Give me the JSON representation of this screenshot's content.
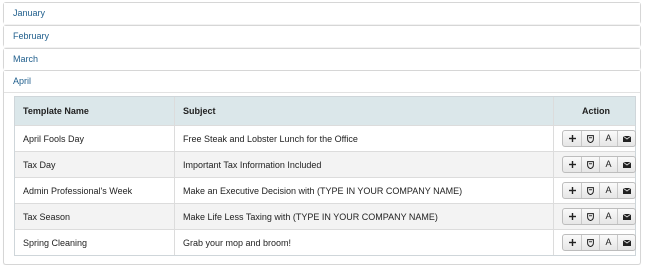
{
  "months": {
    "january": "January",
    "february": "February",
    "march": "March",
    "april": "April"
  },
  "table": {
    "headers": {
      "name": "Template Name",
      "subject": "Subject",
      "action": "Action"
    },
    "rows": [
      {
        "name": "April Fools Day",
        "subject": "Free Steak and Lobster Lunch for the Office"
      },
      {
        "name": "Tax Day",
        "subject": "Important Tax Information Included"
      },
      {
        "name": "Admin Professional's Week",
        "subject": "Make an Executive Decision with (TYPE IN YOUR COMPANY NAME)"
      },
      {
        "name": "Tax Season",
        "subject": "Make Life Less Taxing with (TYPE IN YOUR COMPANY NAME)"
      },
      {
        "name": "Spring Cleaning",
        "subject": "Grab your mop and broom!"
      }
    ]
  },
  "actions": {
    "add_icon": "plus-icon",
    "preview_icon": "shield-icon",
    "font_icon": "font-icon",
    "font_glyph": "A",
    "email_icon": "envelope-icon"
  },
  "colors": {
    "link": "#1f5e8c",
    "header_bg": "#dbe7ea",
    "alt_row_bg": "#f3f3f3"
  }
}
